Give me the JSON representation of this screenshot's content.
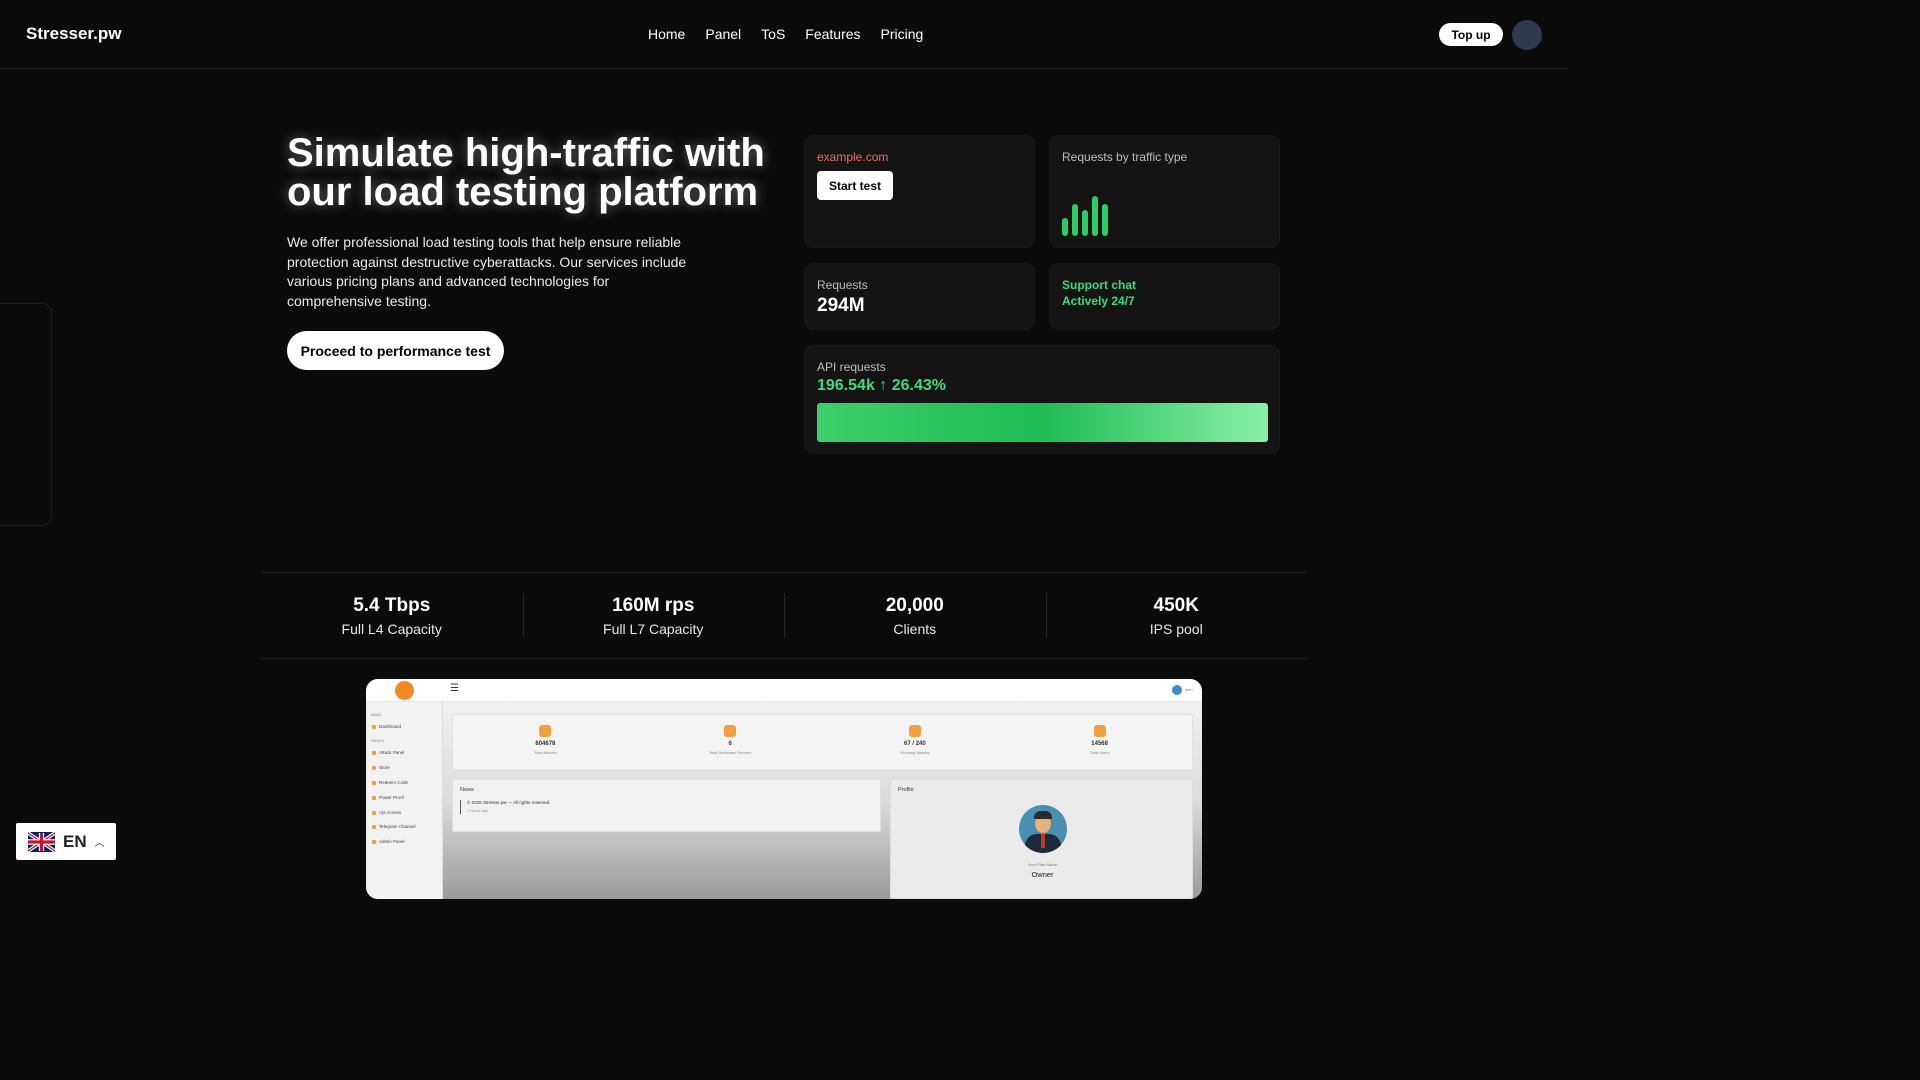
{
  "header": {
    "logo": "Stresser.pw",
    "nav": [
      "Home",
      "Panel",
      "ToS",
      "Features",
      "Pricing"
    ],
    "topup_label": "Top up"
  },
  "hero": {
    "title": "Simulate high-traffic with our load testing platform",
    "description": "We offer professional load testing tools that help ensure reliable protection against destructive cyberattacks. Our services include various pricing plans and advanced technologies for comprehensive testing.",
    "cta": "Proceed to performance test"
  },
  "cards": {
    "target": {
      "domain": "example.com",
      "button": "Start test"
    },
    "traffic_type": {
      "label": "Requests by traffic type",
      "bar_levels": [
        0.45,
        0.8,
        0.65,
        1.0,
        0.8
      ]
    },
    "requests": {
      "label": "Requests",
      "value": "294M"
    },
    "support": {
      "line1": "Support chat",
      "line2": "Actively 24/7"
    },
    "api": {
      "label": "API requests",
      "value": "196.54k ↑ 26.43%"
    }
  },
  "stats": [
    {
      "value": "5.4 Tbps",
      "label": "Full L4 Capacity"
    },
    {
      "value": "160M rps",
      "label": "Full L7 Capacity"
    },
    {
      "value": "20,000",
      "label": "Clients"
    },
    {
      "value": "450K",
      "label": "IPS pool"
    }
  ],
  "preview": {
    "menu_icon": "☰",
    "user": "john",
    "sections": [
      "MAIN",
      "PAGES"
    ],
    "sidebar": [
      "Dashboard",
      "Attack Panel",
      "Store",
      "Redeem Code",
      "Power Proof",
      "Api Access",
      "Telegram Channel",
      "Admin Panel"
    ],
    "stats": [
      {
        "value": "604678",
        "label": "Total Attacks"
      },
      {
        "value": "6",
        "label": "Total Dedicated Servers"
      },
      {
        "value": "67 / 240",
        "label": "Running Attacks"
      },
      {
        "value": "14568",
        "label": "Total Users"
      }
    ],
    "news_title": "News",
    "news_item": "© 2026 Stresser.pw — All rights reserved.",
    "news_time": "1 hours ago",
    "profile_title": "Profile",
    "profile_name": "Your Plan Name",
    "profile_role": "Owner"
  },
  "language": {
    "code": "EN",
    "icon": "uk-flag-icon"
  }
}
